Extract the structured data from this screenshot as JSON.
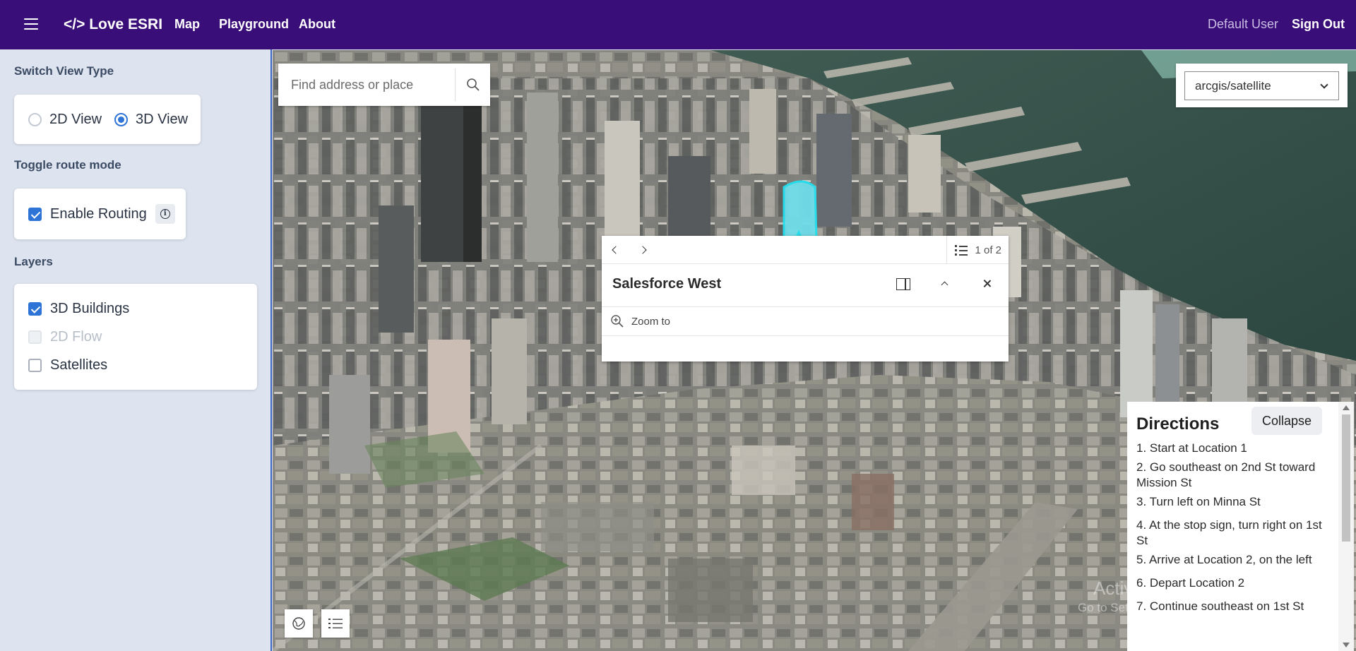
{
  "header": {
    "menu_icon": "hamburger-menu-icon",
    "brand": "</> Love ESRI",
    "nav": [
      "Map",
      "Playground",
      "About"
    ],
    "user": "Default User",
    "sign_out": "Sign Out",
    "background_color": "#3a0e78"
  },
  "sidebar": {
    "view_section": {
      "title": "Switch View Type",
      "options": [
        {
          "label": "2D View",
          "selected": false
        },
        {
          "label": "3D View",
          "selected": true
        }
      ]
    },
    "route_section": {
      "title": "Toggle route mode",
      "toggle": {
        "label": "Enable Routing",
        "checked": true
      },
      "info_icon": "info-icon"
    },
    "layers_section": {
      "title": "Layers",
      "items": [
        {
          "label": "3D Buildings",
          "checked": true,
          "disabled": false
        },
        {
          "label": "2D Flow",
          "checked": false,
          "disabled": true
        },
        {
          "label": "Satellites",
          "checked": false,
          "disabled": false
        }
      ]
    }
  },
  "map": {
    "search": {
      "placeholder": "Find address or place",
      "icon": "search-icon"
    },
    "basemap": {
      "selected": "arcgis/satellite"
    },
    "popup": {
      "counter": "1 of 2",
      "title": "Salesforce West",
      "action": "Zoom to",
      "icons": [
        "chevron-left-icon",
        "chevron-right-icon",
        "list-icon",
        "dock-icon",
        "collapse-icon",
        "close-icon",
        "zoom-to-icon"
      ]
    },
    "directions": {
      "title": "Directions",
      "collapse_label": "Collapse",
      "steps": [
        "1. Start at Location 1",
        "2. Go southeast on 2nd St toward Mission St",
        "3. Turn left on Minna St",
        "4. At the stop sign, turn right on 1st St",
        "5. Arrive at Location 2, on the left",
        "6. Depart Location 2",
        "7. Continue southeast on 1st St"
      ]
    },
    "bottom_buttons": [
      "basemap-gallery-icon",
      "layer-list-icon"
    ],
    "watermark": {
      "line1": "Activate Windows",
      "line2": "Go to Settings to activate Windows."
    }
  }
}
